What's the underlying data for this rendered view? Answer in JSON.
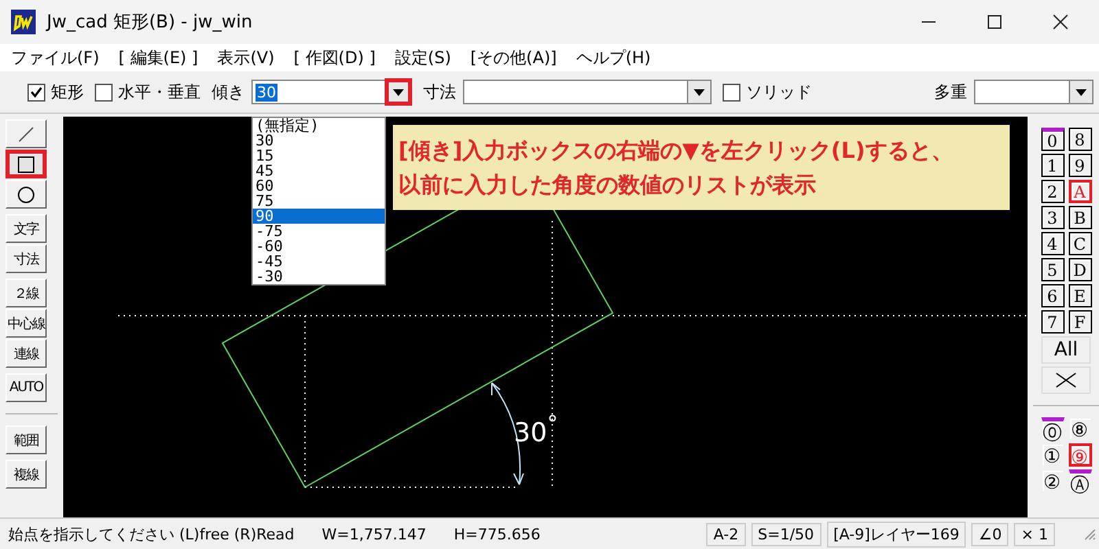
{
  "window": {
    "title": "Jw_cad 矩形(B) - jw_win"
  },
  "menu": [
    {
      "label": "ファイル(F)"
    },
    {
      "label": "[ 編集(E) ]"
    },
    {
      "label": "表示(V)"
    },
    {
      "label": "[ 作図(D) ]"
    },
    {
      "label": "設定(S)"
    },
    {
      "label": "[その他(A)]"
    },
    {
      "label": "ヘルプ(H)"
    }
  ],
  "toolbar": [
    {
      "kind": "checkbox",
      "label": "矩形",
      "checked": true
    },
    {
      "kind": "checkbox",
      "label": "水平・垂直",
      "checked": false
    },
    {
      "kind": "combo",
      "label": "傾き",
      "value": "30",
      "highlighted": true
    },
    {
      "kind": "combo",
      "label": "寸法",
      "highlighted": false
    },
    {
      "kind": "checkbox",
      "label": "ソリッド",
      "checked": false
    },
    {
      "kind": "combo",
      "label": "多重",
      "highlighted": false
    }
  ],
  "dropdown": [
    {
      "label": "(無指定)",
      "selected": false
    },
    {
      "label": "30",
      "selected": false
    },
    {
      "label": "15",
      "selected": false
    },
    {
      "label": "45",
      "selected": false
    },
    {
      "label": "60",
      "selected": false
    },
    {
      "label": "75",
      "selected": false
    },
    {
      "label": "90",
      "selected": true
    },
    {
      "label": "-75",
      "selected": false
    },
    {
      "label": "-60",
      "selected": false
    },
    {
      "label": "-45",
      "selected": false
    },
    {
      "label": "-30",
      "selected": false
    }
  ],
  "callout": {
    "lines": [
      "[傾き]入力ボックスの右端の▼を左クリック(L)すると、",
      "以前に入力した角度の数値のリストが表示"
    ]
  },
  "tool_groups": [
    [
      {
        "kind": "line",
        "selected": false,
        "highlighted": false
      },
      {
        "kind": "rect",
        "selected": true,
        "highlighted": true
      },
      {
        "kind": "circle",
        "selected": false,
        "highlighted": false
      }
    ],
    [
      {
        "kind": "text",
        "label": "文字",
        "selected": false,
        "highlighted": false
      },
      {
        "kind": "text",
        "label": "寸法",
        "selected": false,
        "highlighted": false
      }
    ],
    [
      {
        "kind": "text",
        "label": "２線",
        "selected": false,
        "highlighted": false
      },
      {
        "kind": "text",
        "label": "中心線",
        "selected": false,
        "highlighted": false
      },
      {
        "kind": "text",
        "label": "連線",
        "selected": false,
        "highlighted": false
      }
    ],
    [
      {
        "kind": "text",
        "label": "AUTO",
        "selected": false,
        "highlighted": false
      }
    ],
    [
      {
        "kind": "text",
        "label": "範囲",
        "selected": false,
        "highlighted": false
      }
    ],
    [
      {
        "kind": "text",
        "label": "複線",
        "selected": false,
        "highlighted": false
      }
    ]
  ],
  "layer_groups": [
    [
      {
        "label": "0",
        "marked": true,
        "current": false
      },
      {
        "label": "8",
        "marked": false,
        "current": false
      }
    ],
    [
      {
        "label": "1",
        "marked": false,
        "current": false
      },
      {
        "label": "9",
        "marked": false,
        "current": false
      }
    ],
    [
      {
        "label": "2",
        "marked": false,
        "current": false
      },
      {
        "label": "A",
        "marked": false,
        "current": true
      }
    ],
    [
      {
        "label": "3",
        "marked": false,
        "current": false
      },
      {
        "label": "B",
        "marked": false,
        "current": false
      }
    ],
    [
      {
        "label": "4",
        "marked": false,
        "current": false
      },
      {
        "label": "C",
        "marked": false,
        "current": false
      }
    ],
    [
      {
        "label": "5",
        "marked": false,
        "current": false
      },
      {
        "label": "D",
        "marked": false,
        "current": false
      }
    ],
    [
      {
        "label": "6",
        "marked": false,
        "current": false
      },
      {
        "label": "E",
        "marked": false,
        "current": false
      }
    ],
    [
      {
        "label": "7",
        "marked": false,
        "current": false
      },
      {
        "label": "F",
        "marked": false,
        "current": false
      }
    ]
  ],
  "all_button": "All",
  "layers": [
    [
      {
        "label": "⓪",
        "marked": true,
        "current": false
      },
      {
        "label": "⑧",
        "marked": false,
        "current": false
      }
    ],
    [
      {
        "label": "①",
        "marked": false,
        "current": false
      },
      {
        "label": "⑨",
        "marked": false,
        "current": true
      }
    ],
    [
      {
        "label": "②",
        "marked": false,
        "current": false
      },
      {
        "label": "Ⓐ",
        "marked": true,
        "current": false
      }
    ]
  ],
  "canvas": {
    "angle_label": "30$^{°}$"
  },
  "status_bar": {
    "message": "始点を指示してください (L)free (R)Read",
    "fields": [
      "W=1,757.147",
      "H=775.656"
    ],
    "cells": [
      "A-2",
      "S=1/50",
      "[A-9]レイヤー169",
      "∠0",
      "× 1"
    ]
  }
}
